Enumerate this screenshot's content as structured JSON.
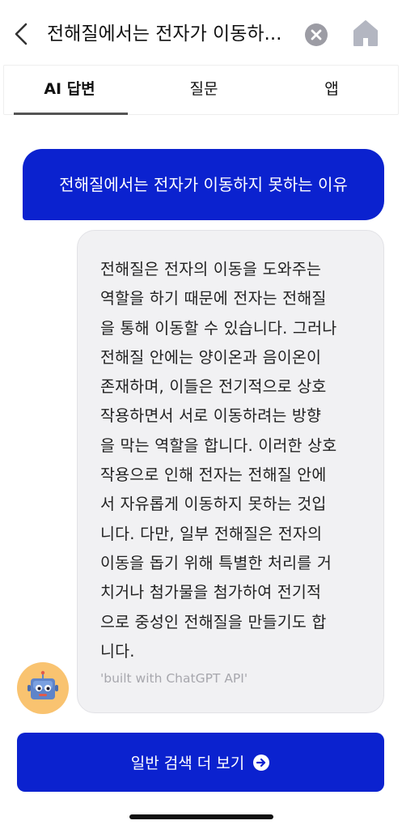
{
  "header": {
    "search_query": "전해질에서는 전자가 이동하...",
    "back_icon": "chevron-left-icon",
    "clear_icon": "close-circle-icon",
    "home_icon": "home-icon"
  },
  "tabs": [
    {
      "label": "AI 답변",
      "active": true
    },
    {
      "label": "질문",
      "active": false
    },
    {
      "label": "앱",
      "active": false
    }
  ],
  "chat": {
    "user_message": "전해질에서는 전자가 이동하지 못하는 이유",
    "answer_lines": [
      "전해질은 전자의 이동을 도와주는",
      "역할을 하기 때문에 전자는 전해질",
      "을 통해 이동할 수 있습니다. 그러나",
      "전해질 안에는 양이온과 음이온이",
      "존재하며, 이들은 전기적으로 상호",
      "작용하면서 서로 이동하려는 방향",
      "을 막는 역할을 합니다. 이러한 상호",
      "작용으로 인해 전자는 전해질 안에",
      "서 자유롭게 이동하지 못하는 것입",
      "니다. 다만, 일부 전해질은 전자의",
      "이동을 돕기 위해 특별한 처리를 거",
      "치거나 첨가물을 첨가하여 전기적",
      "으로 중성인 전해질을 만들기도 합",
      "니다."
    ],
    "credit": "'built with ChatGPT API'",
    "avatar_icon": "robot-mascot-icon"
  },
  "more_button": {
    "label": "일반 검색 더 보기",
    "icon": "arrow-right-circle-icon"
  },
  "colors": {
    "accent": "#0b22cf",
    "card_bg": "#f1f1f3",
    "avatar_bg": "#f9c370"
  }
}
